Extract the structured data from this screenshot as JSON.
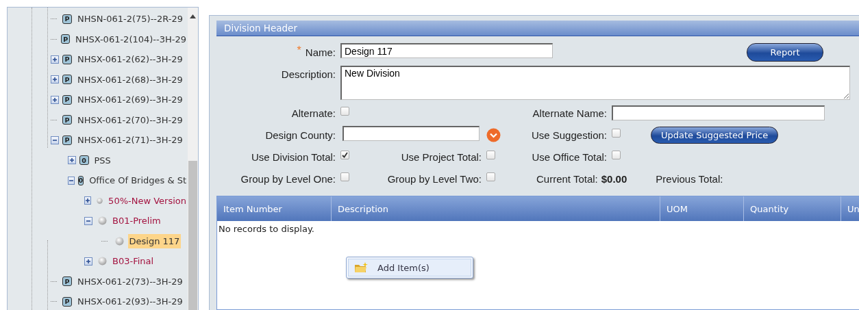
{
  "tree": {
    "items": [
      {
        "label": "NHSN-061-2(75)--2R-29",
        "badge": "P",
        "kind": "project",
        "selected": false
      },
      {
        "label": "NHSX-061-2(104)--3H-29",
        "badge": "P",
        "kind": "project",
        "selected": false
      },
      {
        "label": "NHSX-061-2(62)--3H-29",
        "badge": "P",
        "kind": "project",
        "selected": false,
        "expanded": false
      },
      {
        "label": "NHSX-061-2(68)--3H-29",
        "badge": "P",
        "kind": "project",
        "selected": false,
        "expanded": false
      },
      {
        "label": "NHSX-061-2(69)--3H-29",
        "badge": "P",
        "kind": "project",
        "selected": false,
        "expanded": false
      },
      {
        "label": "NHSX-061-2(70)--3H-29",
        "badge": "P",
        "kind": "project",
        "selected": false
      },
      {
        "label": "NHSX-061-2(71)--3H-29",
        "badge": "P",
        "kind": "project",
        "selected": false,
        "expanded": true,
        "children": [
          {
            "label": "PSS",
            "badge": "0",
            "kind": "office",
            "selected": false,
            "expanded": false
          },
          {
            "label": "Office Of Bridges & St",
            "badge": "0",
            "kind": "office",
            "selected": false,
            "expanded": true,
            "children": [
              {
                "label": "50%-New Version",
                "kind": "version",
                "selected": false,
                "expanded": false
              },
              {
                "label": "B01-Prelim",
                "kind": "version",
                "selected": false,
                "expanded": true,
                "children": [
                  {
                    "label": "Design 117",
                    "kind": "design",
                    "selected": true
                  }
                ]
              },
              {
                "label": "B03-Final",
                "kind": "version",
                "selected": false,
                "expanded": false
              }
            ]
          }
        ]
      },
      {
        "label": "NHSX-061-2(73)--3H-29",
        "badge": "P",
        "kind": "project",
        "selected": false
      },
      {
        "label": "NHSX-061-2(93)--3H-29",
        "badge": "P",
        "kind": "project",
        "selected": false
      }
    ]
  },
  "panel": {
    "title": "Division Header"
  },
  "form": {
    "name": {
      "label": "Name:",
      "value": "Design 117",
      "required_mark": "*"
    },
    "description": {
      "label": "Description:",
      "value": "New Division"
    },
    "alternate": {
      "label": "Alternate:",
      "checked": false
    },
    "alternate_name": {
      "label": "Alternate Name:"
    },
    "design_county": {
      "label": "Design County:"
    },
    "use_suggestion": {
      "label": "Use Suggestion:",
      "checked": false
    },
    "use_division_total": {
      "label": "Use Division Total:",
      "checked": true
    },
    "use_project_total": {
      "label": "Use Project Total:",
      "checked": false
    },
    "use_office_total": {
      "label": "Use Office Total:",
      "checked": false
    },
    "group_by_level_one": {
      "label": "Group by Level One:",
      "checked": false
    },
    "group_by_level_two": {
      "label": "Group by Level Two:",
      "checked": false
    },
    "current_total": {
      "label": "Current Total:",
      "value": "$0.00"
    },
    "previous_total": {
      "label": "Previous Total:"
    }
  },
  "buttons": {
    "report": "Report",
    "update_price": "Update Suggested Price"
  },
  "table": {
    "columns": [
      "Item Number",
      "Description",
      "UOM",
      "Quantity",
      "Un"
    ],
    "empty_message": "No records to display."
  },
  "context_menu": {
    "items": [
      "Add Item(s)"
    ]
  }
}
